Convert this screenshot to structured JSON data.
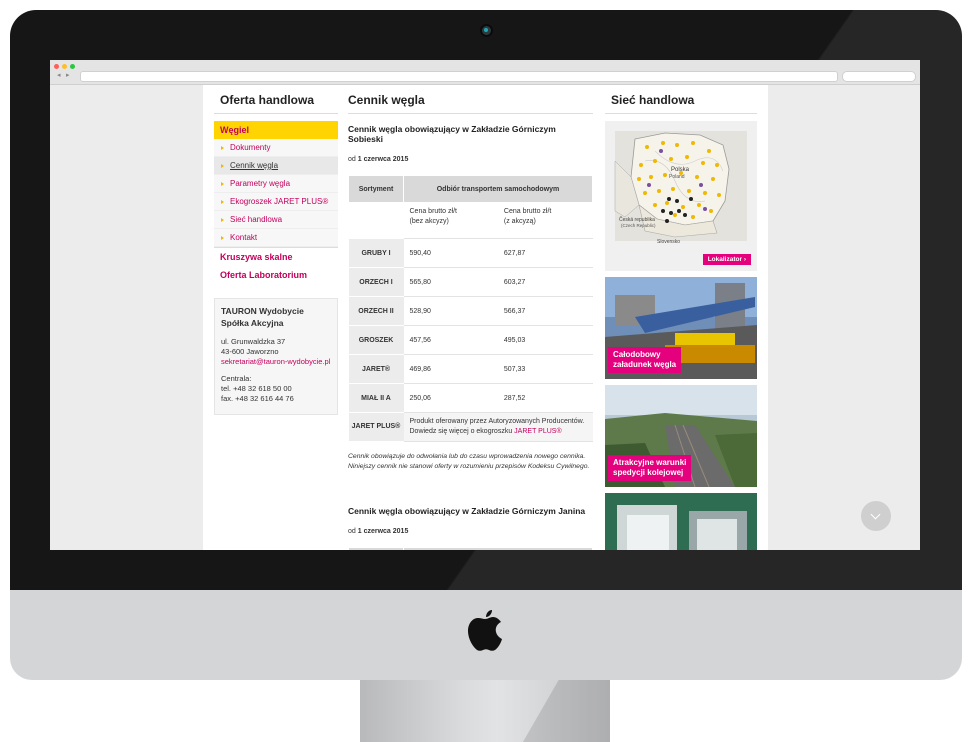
{
  "left": {
    "title": "Oferta handlowa",
    "active": "Węgiel",
    "submenu": [
      "Dokumenty",
      "Cennik węgla",
      "Parametry węgla",
      "Ekogroszek JARET PLUS®",
      "Sieć handlowa",
      "Kontakt"
    ],
    "extra": [
      "Kruszywa skalne",
      "Oferta Laboratorium"
    ],
    "contact": {
      "name1": "TAURON Wydobycie",
      "name2": "Spółka Akcyjna",
      "street": "ul. Grunwaldzka 37",
      "city": "43-600 Jaworzno",
      "email": "sekretariat@tauron-wydobycie.pl",
      "central": "Centrala:",
      "tel": "tel.  +48 32 618 50 00",
      "fax": "fax. +48 32 616 44 76"
    }
  },
  "main": {
    "title": "Cennik węgla",
    "section1": "Cennik węgla obowiązujący w Zakładzie Górniczym Sobieski",
    "date_prefix": "od",
    "date_bold": "1 czerwca 2015",
    "col_sort": "Sortyment",
    "col_transport": "Odbiór transportem samochodowym",
    "col_net": "Cena brutto zł/t",
    "col_net2": "(bez akcyzy)",
    "col_gross": "Cena brutto zł/t",
    "col_gross2": "(z akcyzą)",
    "rows": [
      {
        "name": "GRUBY I",
        "a": "590,40",
        "b": "627,87"
      },
      {
        "name": "ORZECH I",
        "a": "565,80",
        "b": "603,27"
      },
      {
        "name": "ORZECH II",
        "a": "528,90",
        "b": "566,37"
      },
      {
        "name": "GROSZEK",
        "a": "457,56",
        "b": "495,03"
      },
      {
        "name": "JARET®",
        "a": "469,86",
        "b": "507,33"
      },
      {
        "name": "MIAŁ II A",
        "a": "250,06",
        "b": "287,52"
      }
    ],
    "jaret_plus": "JARET PLUS®",
    "jaret_text": "Produkt oferowany przez Autoryzowanych Producentów. Dowiedz się więcej o ekogroszku",
    "jaret_link": "JARET PLUS®",
    "note1": "Cennik obowiązuje do odwołania lub do czasu wprowadzenia nowego cennika.",
    "note2": "Niniejszy cennik nie stanowi oferty w rozumieniu przepisów Kodeksu Cywilnego.",
    "section2": "Cennik węgla obowiązujący w Zakładzie Górniczym Janina",
    "date2_bold": "1 czerwca 2015"
  },
  "right": {
    "title": "Sieć handlowa",
    "map_labels": [
      "Polska",
      "Poland",
      "Česká republika",
      "(Czech Republic)",
      "Slovensko"
    ],
    "lokalizator": "Lokalizator",
    "promo1": [
      "Całodobowy",
      "załadunek węgla"
    ],
    "promo2": [
      "Atrakcyjne warunki",
      "spedycji kolejowej"
    ]
  }
}
